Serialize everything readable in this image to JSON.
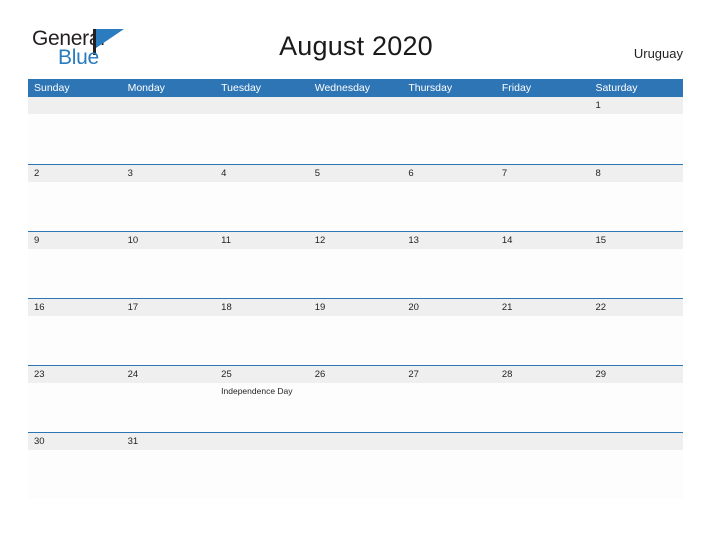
{
  "brand": {
    "name_part1": "General",
    "name_part2": "Blue",
    "flag_icon": "flag-triangle-icon"
  },
  "header": {
    "title": "August 2020",
    "country": "Uruguay"
  },
  "colors": {
    "header_blue": "#2E75B6",
    "logo_blue": "#2B7BBF",
    "day_band_gray": "#EFEFEF",
    "text_dark": "#231F20"
  },
  "calendar": {
    "weekdays": [
      "Sunday",
      "Monday",
      "Tuesday",
      "Wednesday",
      "Thursday",
      "Friday",
      "Saturday"
    ],
    "weeks": [
      [
        {
          "number": "",
          "event": ""
        },
        {
          "number": "",
          "event": ""
        },
        {
          "number": "",
          "event": ""
        },
        {
          "number": "",
          "event": ""
        },
        {
          "number": "",
          "event": ""
        },
        {
          "number": "",
          "event": ""
        },
        {
          "number": "1",
          "event": ""
        }
      ],
      [
        {
          "number": "2",
          "event": ""
        },
        {
          "number": "3",
          "event": ""
        },
        {
          "number": "4",
          "event": ""
        },
        {
          "number": "5",
          "event": ""
        },
        {
          "number": "6",
          "event": ""
        },
        {
          "number": "7",
          "event": ""
        },
        {
          "number": "8",
          "event": ""
        }
      ],
      [
        {
          "number": "9",
          "event": ""
        },
        {
          "number": "10",
          "event": ""
        },
        {
          "number": "11",
          "event": ""
        },
        {
          "number": "12",
          "event": ""
        },
        {
          "number": "13",
          "event": ""
        },
        {
          "number": "14",
          "event": ""
        },
        {
          "number": "15",
          "event": ""
        }
      ],
      [
        {
          "number": "16",
          "event": ""
        },
        {
          "number": "17",
          "event": ""
        },
        {
          "number": "18",
          "event": ""
        },
        {
          "number": "19",
          "event": ""
        },
        {
          "number": "20",
          "event": ""
        },
        {
          "number": "21",
          "event": ""
        },
        {
          "number": "22",
          "event": ""
        }
      ],
      [
        {
          "number": "23",
          "event": ""
        },
        {
          "number": "24",
          "event": ""
        },
        {
          "number": "25",
          "event": "Independence Day"
        },
        {
          "number": "26",
          "event": ""
        },
        {
          "number": "27",
          "event": ""
        },
        {
          "number": "28",
          "event": ""
        },
        {
          "number": "29",
          "event": ""
        }
      ],
      [
        {
          "number": "30",
          "event": ""
        },
        {
          "number": "31",
          "event": ""
        },
        {
          "number": "",
          "event": ""
        },
        {
          "number": "",
          "event": ""
        },
        {
          "number": "",
          "event": ""
        },
        {
          "number": "",
          "event": ""
        },
        {
          "number": "",
          "event": ""
        }
      ]
    ]
  }
}
